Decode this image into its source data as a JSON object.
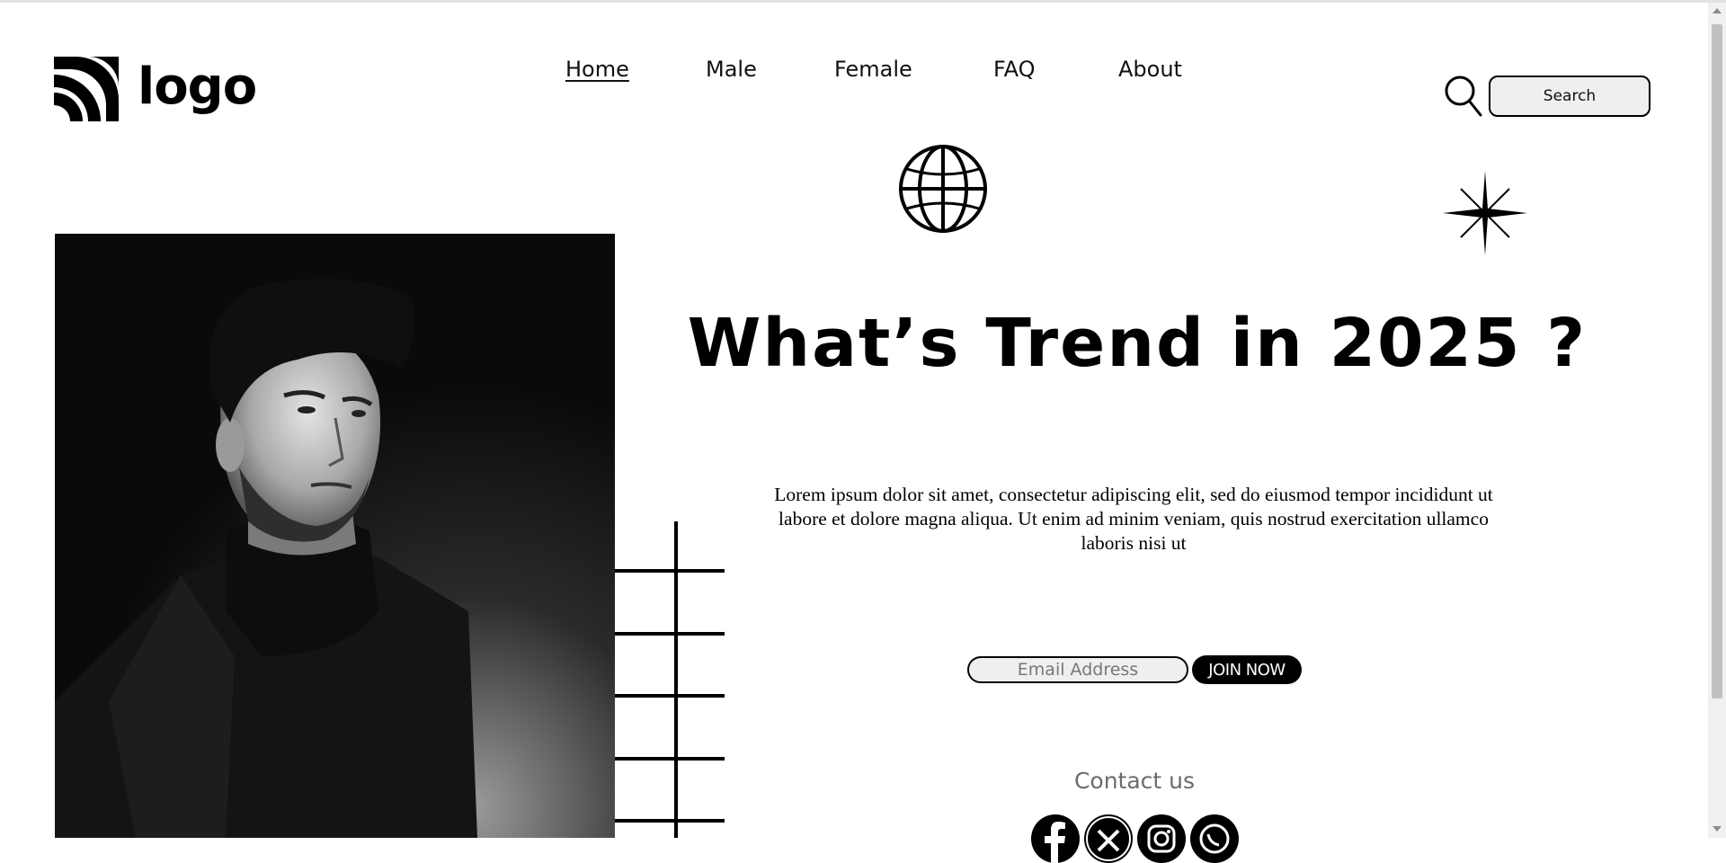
{
  "header": {
    "logo_text": "logo",
    "nav": [
      {
        "label": "Home",
        "active": true
      },
      {
        "label": "Male",
        "active": false
      },
      {
        "label": "Female",
        "active": false
      },
      {
        "label": "FAQ",
        "active": false
      },
      {
        "label": "About",
        "active": false
      }
    ],
    "search": {
      "placeholder": "Search",
      "icon": "search-icon"
    }
  },
  "hero": {
    "title": "What’s Trend in 2025 ?",
    "text": "Lorem ipsum dolor sit amet, consectetur adipiscing elit, sed do eiusmod tempor incididunt ut labore et dolore magna aliqua. Ut enim ad minim veniam, quis nostrud exercitation ullamco laboris nisi ut",
    "email_placeholder": "Email Address",
    "join_label": "JOIN NOW"
  },
  "decorations": [
    "globe-icon",
    "sparkle-star-icon",
    "grid-lines"
  ],
  "contact": {
    "title": "Contact us",
    "socials": [
      "facebook-icon",
      "twitter-icon",
      "instagram-icon",
      "whatsapp-icon"
    ]
  },
  "colors": {
    "primary": "#000000",
    "background": "#ffffff",
    "muted": "#6b6b6b",
    "input_bg": "#efefef"
  }
}
